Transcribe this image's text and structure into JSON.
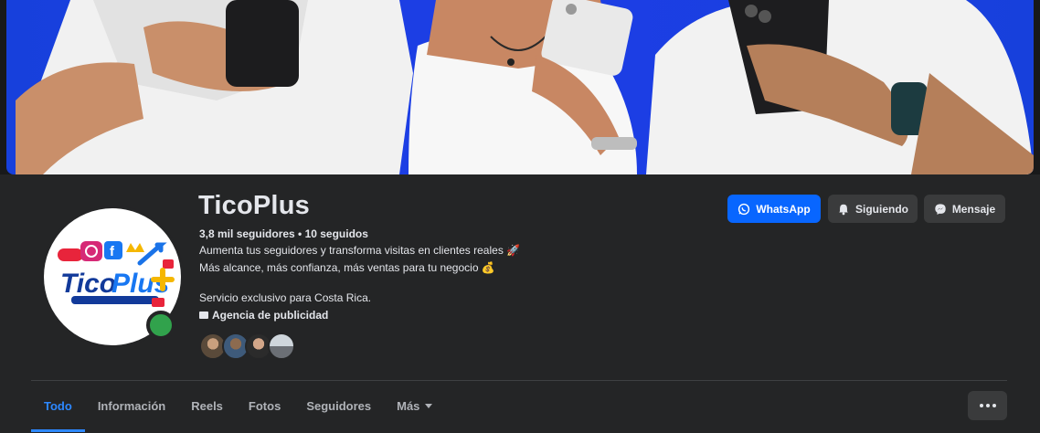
{
  "profile": {
    "name": "TicoPlus",
    "followers_line": "3,8 mil seguidores • 10 seguidos",
    "bio": [
      "Aumenta tus seguidores y transforma visitas en clientes reales 🚀",
      "Más alcance, más confianza, más ventas para tu negocio 💰",
      "",
      "Servicio exclusivo para Costa Rica."
    ],
    "category": "Agencia de publicidad",
    "online": true
  },
  "actions": {
    "whatsapp": "WhatsApp",
    "following": "Siguiendo",
    "message": "Mensaje"
  },
  "tabs": [
    {
      "label": "Todo",
      "active": true
    },
    {
      "label": "Información"
    },
    {
      "label": "Reels"
    },
    {
      "label": "Fotos"
    },
    {
      "label": "Seguidores"
    },
    {
      "label": "Más"
    }
  ],
  "colors": {
    "accent": "#0866ff",
    "tab_active": "#2d88ff",
    "online": "#31a24c",
    "cover_bg": "#1d3ee6"
  },
  "icons": {
    "whatsapp": "whatsapp-icon",
    "following": "bell-icon",
    "message": "messenger-icon",
    "category": "category-icon",
    "more": "more-dots-icon"
  }
}
